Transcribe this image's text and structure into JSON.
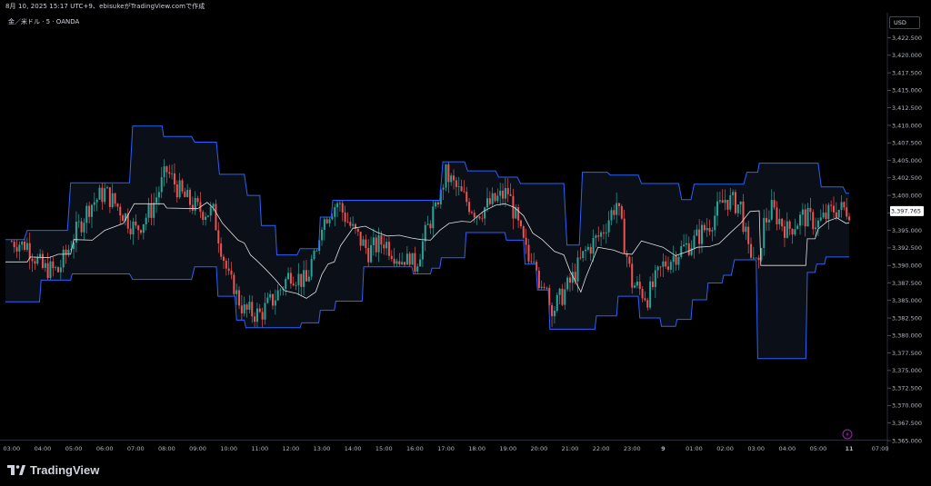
{
  "header": {
    "caption": "8月 10, 2025 15:17 UTC+9、ebisukeがTradingView.comで作成",
    "symbol": "金／米ドル · 5 · OANDA"
  },
  "price_scale": {
    "currency": "USD",
    "last_price": "3,397.765"
  },
  "footer": {
    "logo_text": "TradingView",
    "logo_icon": "tradingview-logo-icon"
  },
  "colors": {
    "background": "#000000",
    "bull": "#26a69a",
    "bear": "#ef5350",
    "channel": "#2962ff",
    "channel_fill": "#0b0f17",
    "midline": "#e0e0e0",
    "last_price_bg": "#ffffff"
  },
  "chart_data": {
    "type": "candlestick",
    "title": "金／米ドル · 5 · OANDA",
    "y_tick_labels": [
      "3,422.500",
      "3,420.000",
      "3,417.500",
      "3,415.000",
      "3,412.500",
      "3,410.000",
      "3,407.500",
      "3,405.000",
      "3,402.500",
      "3,400.000",
      "3,397.500",
      "3,395.000",
      "3,392.500",
      "3,390.000",
      "3,387.500",
      "3,385.000",
      "3,382.500",
      "3,380.000",
      "3,377.500",
      "3,375.000",
      "3,372.500",
      "3,370.000",
      "3,367.500",
      "3,365.000"
    ],
    "ylim": [
      3365,
      3424
    ],
    "x_tick_labels": [
      "03:00",
      "04:00",
      "05:00",
      "06:00",
      "07:00",
      "08:00",
      "09:00",
      "10:00",
      "11:00",
      "12:00",
      "13:00",
      "14:00",
      "15:00",
      "16:00",
      "17:00",
      "18:00",
      "19:00",
      "20:00",
      "21:00",
      "22:00",
      "23:00",
      "9",
      "01:00",
      "02:00",
      "03:00",
      "04:00",
      "05:00",
      "11",
      "07:00"
    ],
    "x_tick_hours": [
      3,
      4,
      5,
      6,
      7,
      8,
      9,
      10,
      11,
      12,
      13,
      14,
      15,
      16,
      17,
      18,
      19,
      20,
      21,
      22,
      23,
      24,
      25,
      26,
      27,
      28,
      29,
      30,
      31
    ],
    "xlim_hours": [
      2.8,
      31.2
    ],
    "x_tick_bold_indices": [
      21,
      27
    ],
    "last_price": 3397.765,
    "close_path": [
      [
        3.0,
        3393.5
      ],
      [
        3.5,
        3393.0
      ],
      [
        4.0,
        3389.5
      ],
      [
        4.5,
        3389.2
      ],
      [
        5.0,
        3394.0
      ],
      [
        5.5,
        3398.5
      ],
      [
        6.0,
        3400.5
      ],
      [
        6.5,
        3398.0
      ],
      [
        7.0,
        3395.0
      ],
      [
        7.5,
        3398.0
      ],
      [
        8.0,
        3403.5
      ],
      [
        8.5,
        3400.0
      ],
      [
        9.0,
        3398.0
      ],
      [
        9.5,
        3397.5
      ],
      [
        10.0,
        3388.0
      ],
      [
        10.5,
        3383.5
      ],
      [
        11.0,
        3383.0
      ],
      [
        11.5,
        3385.5
      ],
      [
        12.0,
        3389.0
      ],
      [
        12.5,
        3387.5
      ],
      [
        13.0,
        3396.5
      ],
      [
        13.5,
        3399.0
      ],
      [
        14.0,
        3395.0
      ],
      [
        14.5,
        3392.0
      ],
      [
        15.0,
        3393.5
      ],
      [
        15.5,
        3391.0
      ],
      [
        16.0,
        3390.0
      ],
      [
        16.5,
        3396.5
      ],
      [
        17.0,
        3403.0
      ],
      [
        17.5,
        3400.0
      ],
      [
        18.0,
        3397.5
      ],
      [
        18.5,
        3399.0
      ],
      [
        19.0,
        3400.5
      ],
      [
        19.5,
        3393.0
      ],
      [
        20.0,
        3386.0
      ],
      [
        20.5,
        3384.0
      ],
      [
        21.0,
        3387.5
      ],
      [
        21.5,
        3392.0
      ],
      [
        22.0,
        3394.5
      ],
      [
        22.5,
        3399.0
      ],
      [
        23.0,
        3387.5
      ],
      [
        23.5,
        3385.5
      ],
      [
        24.0,
        3390.0
      ],
      [
        24.5,
        3392.0
      ],
      [
        25.0,
        3393.5
      ],
      [
        25.5,
        3396.0
      ],
      [
        26.0,
        3399.5
      ],
      [
        26.5,
        3398.5
      ],
      [
        27.0,
        3385.0
      ],
      [
        27.2,
        3395.5
      ],
      [
        27.5,
        3398.0
      ],
      [
        28.0,
        3395.0
      ],
      [
        28.5,
        3397.0
      ],
      [
        29.0,
        3396.0
      ],
      [
        29.5,
        3398.0
      ],
      [
        30.0,
        3398.0
      ]
    ],
    "series": [
      {
        "name": "",
        "role": "channel-upper",
        "points": [
          [
            2.8,
            3393.7
          ],
          [
            3.4,
            3393.7
          ],
          [
            3.5,
            3395.0
          ],
          [
            4.8,
            3395.0
          ],
          [
            4.9,
            3401.8
          ],
          [
            6.8,
            3401.8
          ],
          [
            6.9,
            3409.9
          ],
          [
            7.85,
            3409.9
          ],
          [
            7.9,
            3408.4
          ],
          [
            8.8,
            3408.4
          ],
          [
            8.9,
            3407.6
          ],
          [
            9.6,
            3407.6
          ],
          [
            9.7,
            3403.0
          ],
          [
            10.5,
            3403.0
          ],
          [
            10.6,
            3400.0
          ],
          [
            11.0,
            3400.0
          ],
          [
            11.05,
            3395.7
          ],
          [
            11.5,
            3395.7
          ],
          [
            11.55,
            3391.5
          ],
          [
            12.2,
            3391.5
          ],
          [
            12.3,
            3392.4
          ],
          [
            12.9,
            3392.4
          ],
          [
            12.95,
            3396.9
          ],
          [
            13.3,
            3396.9
          ],
          [
            13.35,
            3399.3
          ],
          [
            16.8,
            3399.3
          ],
          [
            16.9,
            3404.8
          ],
          [
            17.6,
            3404.8
          ],
          [
            17.7,
            3403.5
          ],
          [
            18.6,
            3403.5
          ],
          [
            18.7,
            3402.6
          ],
          [
            19.3,
            3402.6
          ],
          [
            19.4,
            3401.7
          ],
          [
            20.8,
            3401.7
          ],
          [
            20.9,
            3392.9
          ],
          [
            21.3,
            3392.9
          ],
          [
            21.4,
            3403.3
          ],
          [
            22.2,
            3403.3
          ],
          [
            22.3,
            3402.9
          ],
          [
            23.2,
            3402.9
          ],
          [
            23.3,
            3401.7
          ],
          [
            24.5,
            3401.7
          ],
          [
            24.6,
            3399.4
          ],
          [
            24.9,
            3399.4
          ],
          [
            25.0,
            3401.6
          ],
          [
            26.6,
            3401.6
          ],
          [
            26.7,
            3403.3
          ],
          [
            27.05,
            3403.3
          ],
          [
            27.1,
            3404.6
          ],
          [
            29.0,
            3404.6
          ],
          [
            29.1,
            3401.2
          ],
          [
            29.8,
            3401.2
          ],
          [
            29.9,
            3400.3
          ],
          [
            30.0,
            3400.3
          ]
        ]
      },
      {
        "name": "",
        "role": "channel-lower",
        "points": [
          [
            2.8,
            3384.8
          ],
          [
            3.9,
            3384.8
          ],
          [
            3.95,
            3387.9
          ],
          [
            4.9,
            3387.9
          ],
          [
            4.95,
            3388.8
          ],
          [
            6.8,
            3388.8
          ],
          [
            6.9,
            3388.0
          ],
          [
            8.8,
            3388.0
          ],
          [
            8.9,
            3389.8
          ],
          [
            9.6,
            3389.8
          ],
          [
            9.65,
            3385.6
          ],
          [
            10.2,
            3385.6
          ],
          [
            10.25,
            3382.2
          ],
          [
            10.5,
            3382.2
          ],
          [
            10.55,
            3381.1
          ],
          [
            12.3,
            3381.1
          ],
          [
            12.35,
            3381.8
          ],
          [
            12.9,
            3381.8
          ],
          [
            12.95,
            3383.6
          ],
          [
            13.4,
            3383.6
          ],
          [
            13.45,
            3384.9
          ],
          [
            14.3,
            3384.9
          ],
          [
            14.35,
            3389.8
          ],
          [
            15.9,
            3389.8
          ],
          [
            15.95,
            3388.8
          ],
          [
            16.5,
            3388.8
          ],
          [
            16.55,
            3389.6
          ],
          [
            16.8,
            3389.6
          ],
          [
            16.85,
            3391.1
          ],
          [
            17.6,
            3391.1
          ],
          [
            17.65,
            3394.7
          ],
          [
            18.9,
            3394.7
          ],
          [
            18.95,
            3393.6
          ],
          [
            19.5,
            3393.6
          ],
          [
            19.55,
            3390.2
          ],
          [
            19.9,
            3390.2
          ],
          [
            19.95,
            3386.5
          ],
          [
            20.3,
            3386.5
          ],
          [
            20.35,
            3380.9
          ],
          [
            21.8,
            3380.9
          ],
          [
            21.85,
            3382.8
          ],
          [
            22.5,
            3382.8
          ],
          [
            22.55,
            3385.6
          ],
          [
            23.2,
            3385.6
          ],
          [
            23.25,
            3382.5
          ],
          [
            23.9,
            3382.5
          ],
          [
            23.95,
            3381.3
          ],
          [
            24.4,
            3381.3
          ],
          [
            24.45,
            3382.3
          ],
          [
            24.9,
            3382.3
          ],
          [
            24.95,
            3385.1
          ],
          [
            25.4,
            3385.1
          ],
          [
            25.45,
            3387.5
          ],
          [
            25.9,
            3387.5
          ],
          [
            25.95,
            3388.6
          ],
          [
            26.2,
            3388.6
          ],
          [
            26.3,
            3390.8
          ],
          [
            27.0,
            3390.8
          ],
          [
            27.05,
            3376.7
          ],
          [
            28.6,
            3376.7
          ],
          [
            28.65,
            3389.0
          ],
          [
            28.9,
            3389.0
          ],
          [
            28.95,
            3390.2
          ],
          [
            29.2,
            3390.2
          ],
          [
            29.25,
            3391.2
          ],
          [
            30.0,
            3391.2
          ]
        ]
      },
      {
        "name": "",
        "role": "mid-line",
        "points": [
          [
            2.8,
            3390.5
          ],
          [
            3.5,
            3390.5
          ],
          [
            3.6,
            3391.2
          ],
          [
            4.2,
            3391.1
          ],
          [
            4.5,
            3391.6
          ],
          [
            4.9,
            3391.6
          ],
          [
            5.0,
            3393.7
          ],
          [
            5.6,
            3393.6
          ],
          [
            6.0,
            3395.0
          ],
          [
            6.6,
            3396.0
          ],
          [
            6.95,
            3398.8
          ],
          [
            7.9,
            3398.8
          ],
          [
            8.0,
            3398.2
          ],
          [
            9.0,
            3398.1
          ],
          [
            9.3,
            3399.0
          ],
          [
            9.5,
            3398.2
          ],
          [
            9.8,
            3396.0
          ],
          [
            10.3,
            3393.6
          ],
          [
            10.5,
            3393.2
          ],
          [
            10.7,
            3391.5
          ],
          [
            10.9,
            3390.7
          ],
          [
            11.2,
            3389.4
          ],
          [
            11.5,
            3388.0
          ],
          [
            11.8,
            3386.4
          ],
          [
            12.2,
            3386.0
          ],
          [
            12.5,
            3385.3
          ],
          [
            12.8,
            3386.2
          ],
          [
            13.0,
            3388.7
          ],
          [
            13.2,
            3390.2
          ],
          [
            13.4,
            3390.5
          ],
          [
            13.6,
            3392.8
          ],
          [
            14.0,
            3395.3
          ],
          [
            14.4,
            3395.6
          ],
          [
            14.8,
            3394.7
          ],
          [
            15.1,
            3394.2
          ],
          [
            15.5,
            3394.3
          ],
          [
            15.9,
            3393.9
          ],
          [
            16.2,
            3393.7
          ],
          [
            16.5,
            3393.6
          ],
          [
            16.8,
            3395.0
          ],
          [
            17.1,
            3396.0
          ],
          [
            17.5,
            3396.3
          ],
          [
            17.8,
            3396.2
          ],
          [
            18.2,
            3397.7
          ],
          [
            18.6,
            3398.6
          ],
          [
            18.9,
            3398.8
          ],
          [
            19.2,
            3398.3
          ],
          [
            19.5,
            3397.1
          ],
          [
            19.8,
            3394.6
          ],
          [
            20.1,
            3393.7
          ],
          [
            20.5,
            3392.0
          ],
          [
            20.8,
            3391.5
          ],
          [
            21.0,
            3389.2
          ],
          [
            21.2,
            3387.5
          ],
          [
            21.35,
            3386.2
          ],
          [
            21.5,
            3388.2
          ],
          [
            21.9,
            3392.6
          ],
          [
            22.4,
            3392.2
          ],
          [
            22.7,
            3391.7
          ],
          [
            23.0,
            3391.6
          ],
          [
            23.3,
            3393.5
          ],
          [
            23.6,
            3393.1
          ],
          [
            24.0,
            3392.6
          ],
          [
            24.4,
            3391.4
          ],
          [
            24.8,
            3392.0
          ],
          [
            25.1,
            3392.6
          ],
          [
            25.5,
            3392.7
          ],
          [
            25.8,
            3393.1
          ],
          [
            26.2,
            3394.8
          ],
          [
            26.5,
            3396.0
          ],
          [
            26.8,
            3397.7
          ],
          [
            27.1,
            3397.8
          ],
          [
            27.15,
            3390.0
          ],
          [
            28.6,
            3390.0
          ],
          [
            28.65,
            3393.8
          ],
          [
            28.9,
            3393.8
          ],
          [
            29.0,
            3395.2
          ],
          [
            29.3,
            3396.3
          ],
          [
            29.6,
            3396.8
          ],
          [
            29.9,
            3396.0
          ],
          [
            30.0,
            3396.1
          ]
        ]
      }
    ],
    "grid": false,
    "legend": false
  }
}
